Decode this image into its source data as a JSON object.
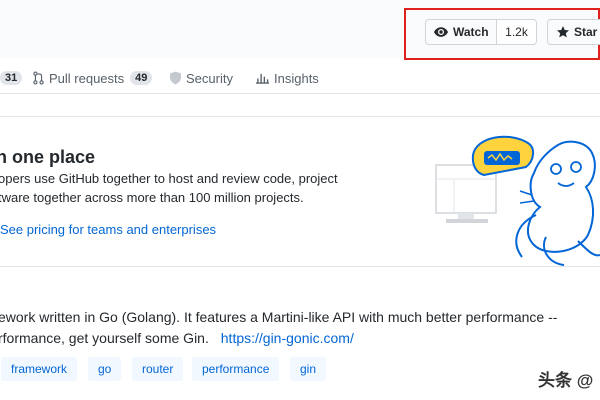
{
  "header": {
    "watch_label": "Watch",
    "watch_count": "1.2k",
    "star_label": "Star",
    "highlight_color": "#e0201b"
  },
  "tabs": {
    "issues_count": "31",
    "pull_requests_label": "Pull requests",
    "pull_requests_count": "49",
    "security_label": "Security",
    "insights_label": "Insights"
  },
  "banner": {
    "title": "n one place",
    "line1": "opers use GitHub together to host and review code, project",
    "line2": "tware together across more than 100 million projects.",
    "link": "See pricing for teams and enterprises"
  },
  "about": {
    "line1": "ework written in Go (Golang). It features a Martini-like API with much better performance --",
    "line2": "rformance, get yourself some Gin.",
    "url": "https://gin-gonic.com/"
  },
  "topics": [
    "framework",
    "go",
    "router",
    "performance",
    "gin"
  ],
  "watermark": "头条 @",
  "icons": {
    "watch": "eye-icon",
    "star": "star-icon",
    "pull_requests": "git-pull-request-icon",
    "security": "shield-icon",
    "insights": "graph-icon"
  },
  "colors": {
    "link": "#0366d6",
    "topic_bg": "#f1f8ff",
    "text": "#24292e",
    "muted": "#586069"
  }
}
